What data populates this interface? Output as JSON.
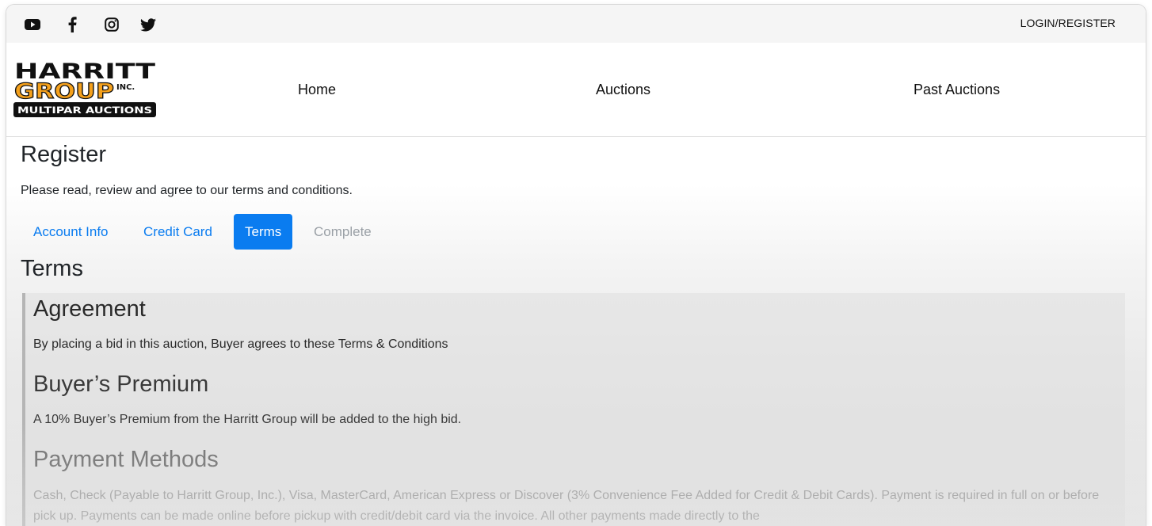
{
  "topbar": {
    "social": [
      {
        "name": "youtube-icon"
      },
      {
        "name": "facebook-icon"
      },
      {
        "name": "instagram-icon"
      },
      {
        "name": "twitter-icon"
      }
    ],
    "login_label": "LOGIN/REGISTER"
  },
  "logo": {
    "line1": "HARRITT",
    "line2": "GROUP",
    "suffix": "INC.",
    "tagline": "MULTIPAR AUCTIONS",
    "colors": {
      "black": "#111111",
      "orange": "#f5a11c"
    }
  },
  "nav": {
    "home": "Home",
    "auctions": "Auctions",
    "past_auctions": "Past Auctions"
  },
  "page": {
    "title": "Register",
    "intro": "Please read, review and agree to our terms and conditions."
  },
  "tabs": [
    {
      "label": "Account Info",
      "state": "link"
    },
    {
      "label": "Credit Card",
      "state": "link"
    },
    {
      "label": "Terms",
      "state": "active"
    },
    {
      "label": "Complete",
      "state": "disabled"
    }
  ],
  "terms": {
    "title": "Terms",
    "sections": [
      {
        "heading": "Agreement",
        "body": "By placing a bid in this auction, Buyer agrees to these Terms & Conditions"
      },
      {
        "heading": "Buyer’s Premium",
        "body": "A 10% Buyer’s Premium from the Harritt Group will be added to the high bid."
      },
      {
        "heading": "Payment Methods",
        "body": "Cash, Check (Payable to Harritt Group, Inc.), Visa, MasterCard, American Express or Discover (3% Convenience Fee Added for Credit & Debit Cards). Payment is required in full on or before pick up. Payments can be made online before pickup with credit/debit card via the invoice. All other payments made directly to the"
      }
    ]
  },
  "colors": {
    "accent": "#0a7cf0",
    "disabled": "#9aa0a6",
    "text": "#212529"
  }
}
